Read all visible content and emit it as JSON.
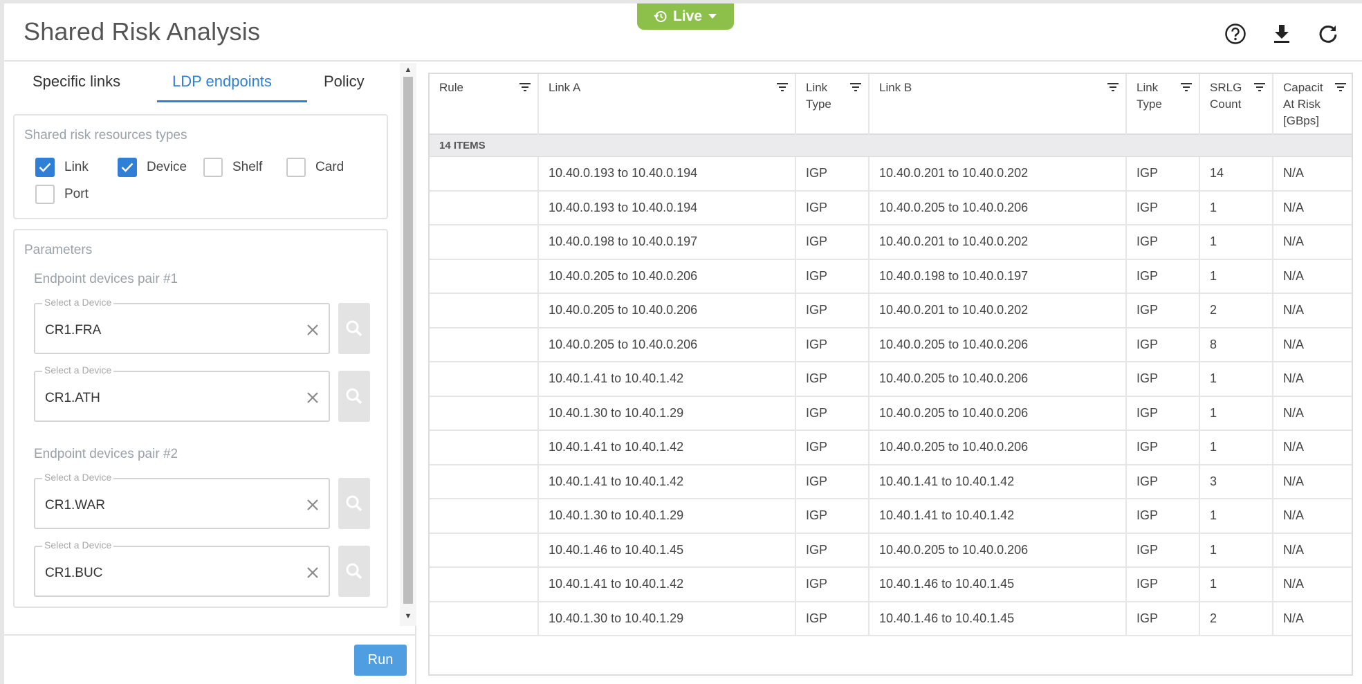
{
  "header": {
    "title": "Shared Risk Analysis",
    "live_label": "Live",
    "icons": [
      "help-icon",
      "download-icon",
      "refresh-icon"
    ]
  },
  "colors": {
    "live_green": "#8cc04b",
    "accent_blue": "#2f7fd6",
    "run_button": "#4f9ee2"
  },
  "left_panel": {
    "tabs": [
      {
        "label": "Specific links",
        "active": false
      },
      {
        "label": "LDP endpoints",
        "active": true
      },
      {
        "label": "Policy",
        "active": false
      }
    ],
    "resources": {
      "title": "Shared risk resources types",
      "options": [
        {
          "label": "Link",
          "checked": true
        },
        {
          "label": "Device",
          "checked": true
        },
        {
          "label": "Shelf",
          "checked": false
        },
        {
          "label": "Card",
          "checked": false
        },
        {
          "label": "Port",
          "checked": false
        }
      ]
    },
    "parameters": {
      "title": "Parameters",
      "pairs": [
        {
          "title": "Endpoint devices pair #1",
          "fields": [
            {
              "label": "Select a Device",
              "value": "CR1.FRA"
            },
            {
              "label": "Select a Device",
              "value": "CR1.ATH"
            }
          ]
        },
        {
          "title": "Endpoint devices pair #2",
          "fields": [
            {
              "label": "Select a Device",
              "value": "CR1.WAR"
            },
            {
              "label": "Select a Device",
              "value": "CR1.BUC"
            }
          ]
        }
      ]
    },
    "run_label": "Run"
  },
  "grid": {
    "columns": [
      {
        "label": "Rule"
      },
      {
        "label": "Link A"
      },
      {
        "label": "Link\nType"
      },
      {
        "label": "Link B"
      },
      {
        "label": "Link\nType"
      },
      {
        "label": "SRLG\nCount"
      },
      {
        "label": "Capacit\nAt Risk\n[GBps]"
      }
    ],
    "group_label": "14 ITEMS",
    "rows": [
      [
        "",
        "10.40.0.193 to 10.40.0.194",
        "IGP",
        "10.40.0.201 to 10.40.0.202",
        "IGP",
        "14",
        "N/A"
      ],
      [
        "",
        "10.40.0.193 to 10.40.0.194",
        "IGP",
        "10.40.0.205 to 10.40.0.206",
        "IGP",
        "1",
        "N/A"
      ],
      [
        "",
        "10.40.0.198 to 10.40.0.197",
        "IGP",
        "10.40.0.201 to 10.40.0.202",
        "IGP",
        "1",
        "N/A"
      ],
      [
        "",
        "10.40.0.205 to 10.40.0.206",
        "IGP",
        "10.40.0.198 to 10.40.0.197",
        "IGP",
        "1",
        "N/A"
      ],
      [
        "",
        "10.40.0.205 to 10.40.0.206",
        "IGP",
        "10.40.0.201 to 10.40.0.202",
        "IGP",
        "2",
        "N/A"
      ],
      [
        "",
        "10.40.0.205 to 10.40.0.206",
        "IGP",
        "10.40.0.205 to 10.40.0.206",
        "IGP",
        "8",
        "N/A"
      ],
      [
        "",
        "10.40.1.41 to 10.40.1.42",
        "IGP",
        "10.40.0.205 to 10.40.0.206",
        "IGP",
        "1",
        "N/A"
      ],
      [
        "",
        "10.40.1.30 to 10.40.1.29",
        "IGP",
        "10.40.0.205 to 10.40.0.206",
        "IGP",
        "1",
        "N/A"
      ],
      [
        "",
        "10.40.1.41 to 10.40.1.42",
        "IGP",
        "10.40.0.205 to 10.40.0.206",
        "IGP",
        "1",
        "N/A"
      ],
      [
        "",
        "10.40.1.41 to 10.40.1.42",
        "IGP",
        "10.40.1.41 to 10.40.1.42",
        "IGP",
        "3",
        "N/A"
      ],
      [
        "",
        "10.40.1.30 to 10.40.1.29",
        "IGP",
        "10.40.1.41 to 10.40.1.42",
        "IGP",
        "1",
        "N/A"
      ],
      [
        "",
        "10.40.1.46 to 10.40.1.45",
        "IGP",
        "10.40.0.205 to 10.40.0.206",
        "IGP",
        "1",
        "N/A"
      ],
      [
        "",
        "10.40.1.41 to 10.40.1.42",
        "IGP",
        "10.40.1.46 to 10.40.1.45",
        "IGP",
        "1",
        "N/A"
      ],
      [
        "",
        "10.40.1.30 to 10.40.1.29",
        "IGP",
        "10.40.1.46 to 10.40.1.45",
        "IGP",
        "2",
        "N/A"
      ]
    ]
  }
}
